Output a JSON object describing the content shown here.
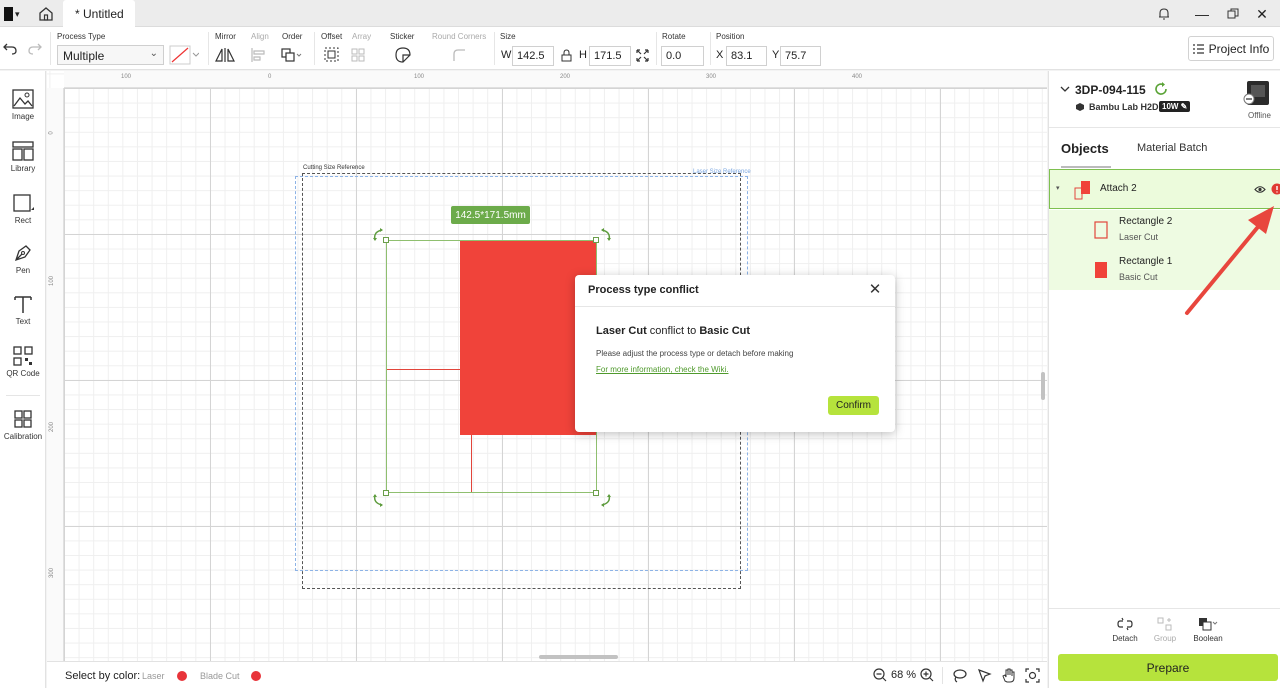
{
  "window": {
    "tab_title": "* Untitled"
  },
  "toolbar": {
    "process_type_label": "Process Type",
    "process_type_value": "Multiple",
    "mirror_label": "Mirror",
    "align_label": "Align",
    "order_label": "Order",
    "offset_label": "Offset",
    "array_label": "Array",
    "sticker_label": "Sticker",
    "round_corners_label": "Round Corners",
    "size_label": "Size",
    "width_letter": "W",
    "width_value": "142.5",
    "height_letter": "H",
    "height_value": "171.5",
    "rotate_label": "Rotate",
    "rotate_value": "0.0",
    "position_label": "Position",
    "x_letter": "X",
    "x_value": "83.1",
    "y_letter": "Y",
    "y_value": "75.7",
    "project_info_label": "Project Info"
  },
  "sidebar": {
    "tools": [
      {
        "label": "Image",
        "icon": "image-icon"
      },
      {
        "label": "Library",
        "icon": "library-icon"
      },
      {
        "label": "Rect",
        "icon": "rect-icon"
      },
      {
        "label": "Pen",
        "icon": "pen-icon"
      },
      {
        "label": "Text",
        "icon": "text-icon"
      },
      {
        "label": "QR Code",
        "icon": "qr-code-icon"
      },
      {
        "label": "Calibration",
        "icon": "calibration-icon"
      }
    ]
  },
  "canvas": {
    "ruler_top": [
      "100",
      "0",
      "100",
      "200",
      "300",
      "400"
    ],
    "ruler_left": [
      "0",
      "100",
      "200",
      "300"
    ],
    "cutting_ref_label": "Cutting Size Reference",
    "laser_ref_label": "Laser Size Reference",
    "dimension_badge": "142.5*171.5mm"
  },
  "dialog": {
    "title": "Process type conflict",
    "msg_part1": "Laser Cut",
    "msg_part2": " conflict to ",
    "msg_part3": "Basic Cut",
    "sub": "Please adjust the process type or detach before making",
    "link": "For more information, check the Wiki.",
    "confirm": "Confirm"
  },
  "statusbar": {
    "select_by_color": "Select by color:",
    "color1_label": "Laser",
    "color2_label": "Blade Cut",
    "zoom_value": "68 %"
  },
  "right_panel": {
    "device_name": "3DP-094-115",
    "device_model": "Bambu Lab H2D",
    "power_badge": "10W",
    "status": "Offline",
    "tab_objects": "Objects",
    "tab_material": "Material Batch",
    "group_name": "Attach 2",
    "children": [
      {
        "name": "Rectangle 2",
        "process": "Laser Cut"
      },
      {
        "name": "Rectangle 1",
        "process": "Basic Cut"
      }
    ],
    "tools": {
      "detach": "Detach",
      "group": "Group",
      "boolean": "Boolean"
    },
    "prepare": "Prepare"
  },
  "colors": {
    "accent_green": "#b6e33c",
    "shape_red": "#f0433a",
    "selection_green": "#6cab4a"
  }
}
